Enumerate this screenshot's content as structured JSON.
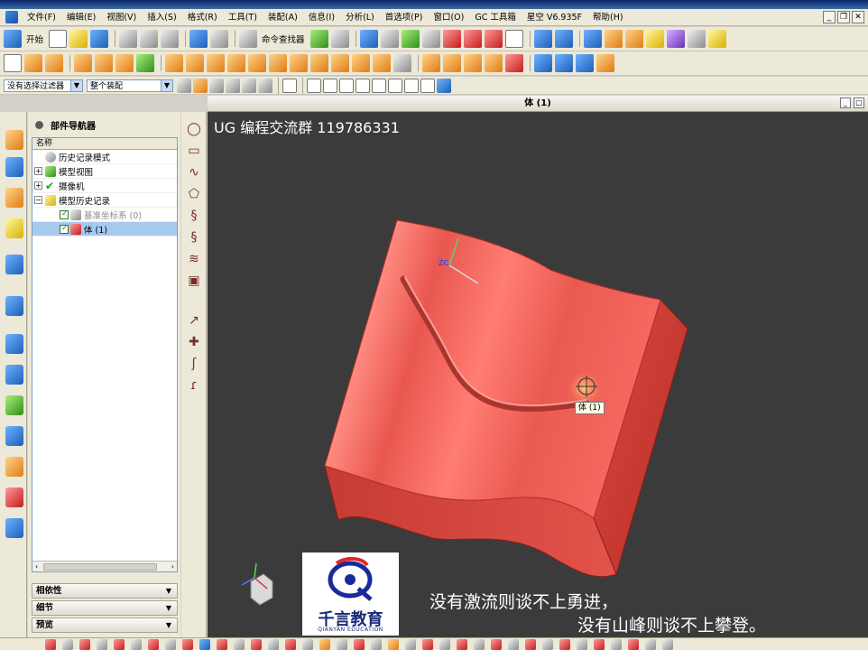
{
  "menu": {
    "items": [
      "文件(F)",
      "编辑(E)",
      "视图(V)",
      "插入(S)",
      "格式(R)",
      "工具(T)",
      "装配(A)",
      "信息(I)",
      "分析(L)",
      "首选项(P)",
      "窗口(O)",
      "GC 工具箱",
      "星空 V6.935F",
      "帮助(H)"
    ]
  },
  "toolbar": {
    "start_label": "开始",
    "command_finder_label": "命令查找器",
    "filter_value": "没有选择过滤器",
    "assembly_scope_value": "整个装配"
  },
  "navigator": {
    "title": "部件导航器",
    "column_name": "名称",
    "rows": [
      {
        "label": "历史记录模式"
      },
      {
        "label": "模型视图"
      },
      {
        "label": "摄像机"
      },
      {
        "label": "模型历史记录"
      },
      {
        "label": "基准坐标系 (0)"
      },
      {
        "label": "体 (1)"
      }
    ],
    "sections": [
      "相依性",
      "细节",
      "预览"
    ]
  },
  "viewport": {
    "title": "体 (1)",
    "watermark": "UG 编程交流群 119786331",
    "tooltip": "体 (1)",
    "logo_name": "千言教育",
    "logo_en": "QIANYAN EDUCATION",
    "subtitle_1": "没有激流则谈不上勇进，",
    "subtitle_2": "没有山峰则谈不上攀登。",
    "body_color": "#f06a60"
  }
}
